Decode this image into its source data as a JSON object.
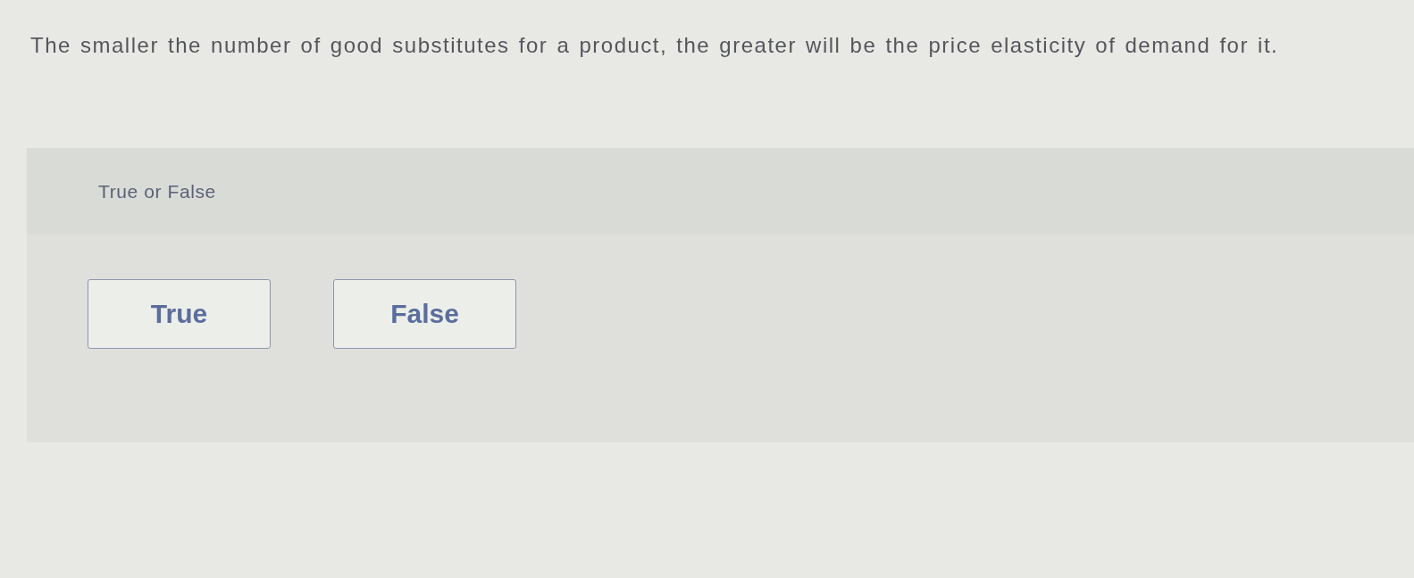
{
  "question": {
    "text": "The smaller the number of good substitutes for a product, the greater will be the price elasticity of demand for it."
  },
  "answer_panel": {
    "prompt": "True or False",
    "options": [
      {
        "label": "True",
        "selected": false
      },
      {
        "label": "False",
        "selected": false
      }
    ]
  }
}
